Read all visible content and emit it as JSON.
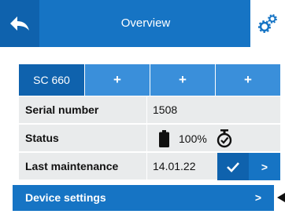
{
  "header": {
    "title": "Overview",
    "back_icon": "back-arrow-icon",
    "settings_icon": "gears-icon"
  },
  "tabs": [
    {
      "label": "SC 660",
      "active": true
    },
    {
      "label": "+",
      "active": false
    },
    {
      "label": "+",
      "active": false
    },
    {
      "label": "+",
      "active": false
    }
  ],
  "rows": {
    "serial_number": {
      "label": "Serial number",
      "value": "1508"
    },
    "status": {
      "label": "Status",
      "battery_value": "100%",
      "battery_icon": "battery-full-icon",
      "timer_icon": "timer-check-icon"
    },
    "last_maintenance": {
      "label": "Last maintenance",
      "value": "14.01.22",
      "arrow": ">"
    }
  },
  "device_settings": {
    "label": "Device settings",
    "arrow": ">"
  },
  "colors": {
    "primary": "#1674c4",
    "dark": "#0f62ad",
    "light": "#3a8fda",
    "row_bg": "#e9ebec"
  }
}
